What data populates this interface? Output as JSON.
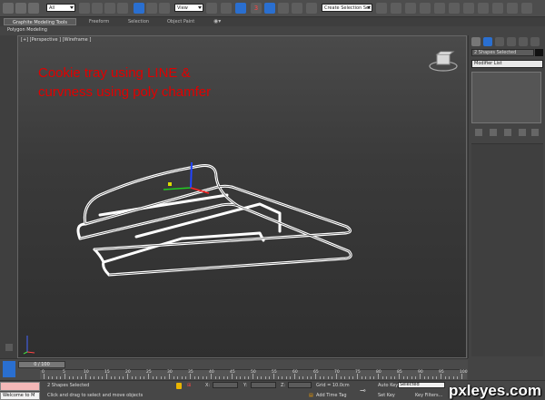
{
  "toolbar": {
    "filter_value": "All",
    "view_value": "View",
    "selection_set_value": "Create Selection Set"
  },
  "ribbon": {
    "tabs": [
      "Graphite Modeling Tools",
      "Freeform",
      "Selection",
      "Object Paint"
    ],
    "sub_label": "Polygon Modeling"
  },
  "viewport": {
    "label": "[+] [Perspective ] [Wireframe ]",
    "caption_line1": "Cookie tray using LINE &",
    "caption_line2": "curvness using poly chamfer"
  },
  "command_panel": {
    "selection_text": "2 Shapes Selected",
    "modifier_list": "Modifier List"
  },
  "timeline": {
    "slider_text": "0 / 100",
    "ticks": [
      "0",
      "5",
      "10",
      "15",
      "20",
      "25",
      "30",
      "35",
      "40",
      "45",
      "50",
      "55",
      "60",
      "65",
      "70",
      "75",
      "80",
      "85",
      "90",
      "95",
      "100"
    ]
  },
  "status": {
    "maxscript": "Welcome to M",
    "shapes_selected": "2 Shapes Selected",
    "prompt": "Click and drag to select and move objects",
    "x_label": "X:",
    "y_label": "Y:",
    "z_label": "Z:",
    "grid": "Grid = 10.0cm",
    "add_time_tag": "Add Time Tag",
    "auto_key": "Auto Key",
    "auto_key_value": "Selected",
    "set_key": "Set Key",
    "key_filters": "Key Filters..."
  },
  "watermark": "pxleyes.com",
  "colors": {
    "caption": "#e00000",
    "wire": "#ffffff",
    "viewport_bg": "#3a3a3a"
  }
}
